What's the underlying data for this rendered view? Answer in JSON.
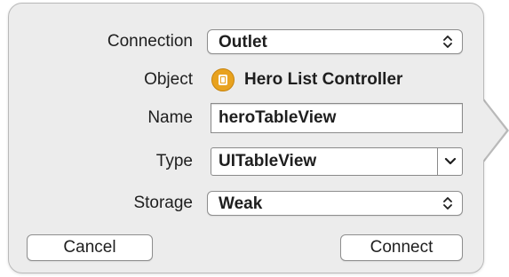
{
  "dialog": {
    "connection": {
      "label": "Connection",
      "value": "Outlet",
      "control_icon": "up-down-stepper-icon"
    },
    "object": {
      "label": "Object",
      "icon": "view-controller-icon",
      "value": "Hero List Controller",
      "icon_color": "#e8a21f"
    },
    "name": {
      "label": "Name",
      "value": "heroTableView"
    },
    "type": {
      "label": "Type",
      "value": "UITableView",
      "control_icon": "chevron-down-icon"
    },
    "storage": {
      "label": "Storage",
      "value": "Weak",
      "control_icon": "up-down-stepper-icon"
    },
    "buttons": {
      "cancel": "Cancel",
      "connect": "Connect"
    }
  },
  "colors": {
    "panel_background": "#ececec",
    "panel_border": "#b9b9b9",
    "text": "#1e1e1e"
  }
}
